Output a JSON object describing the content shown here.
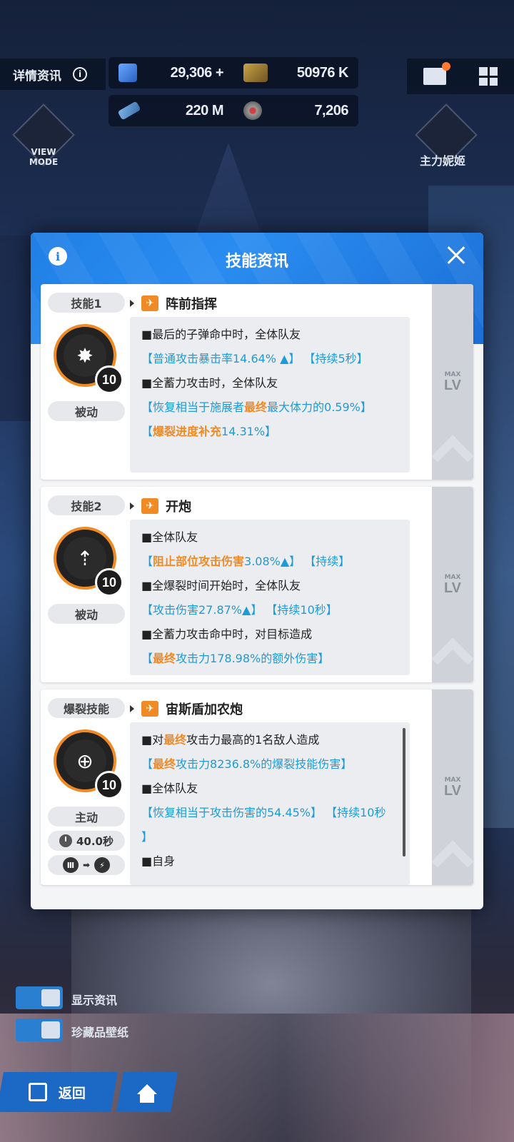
{
  "hud": {
    "details_label": "详情资讯",
    "gems": "29,306",
    "gems_plus": "+",
    "credits": "50976 K",
    "core_dust": "220 M",
    "items": "7,206"
  },
  "side": {
    "view_mode": "VIEW\nMODE",
    "main_nikke": "主力妮姬"
  },
  "modal": {
    "title": "技能资讯",
    "max_label": "MAX",
    "lv_label": "LV"
  },
  "skills": [
    {
      "slot": "技能1",
      "name": "阵前指挥",
      "type": "被动",
      "level": "10",
      "lines": [
        [
          {
            "t": "■最后的子弹命中时，全体队友",
            "c": ""
          }
        ],
        [
          {
            "t": "【普通攻击暴击率14.64% ▲】 【持续5秒】",
            "c": "blue"
          }
        ],
        [
          {
            "t": "■全蓄力攻击时，全体队友",
            "c": ""
          }
        ],
        [
          {
            "t": "【恢复相当于施展者",
            "c": "blue"
          },
          {
            "t": "最终",
            "c": "orange"
          },
          {
            "t": "最大体力的0.59%】",
            "c": "blue"
          }
        ],
        [
          {
            "t": "【",
            "c": "blue"
          },
          {
            "t": "爆裂进度补充",
            "c": "orange"
          },
          {
            "t": "14.31%】",
            "c": "blue"
          }
        ]
      ]
    },
    {
      "slot": "技能2",
      "name": "开炮",
      "type": "被动",
      "level": "10",
      "lines": [
        [
          {
            "t": "■全体队友",
            "c": ""
          }
        ],
        [
          {
            "t": "【",
            "c": "blue"
          },
          {
            "t": "阻止部位攻击伤害",
            "c": "orange"
          },
          {
            "t": "3.08%▲】 【持续】",
            "c": "blue"
          }
        ],
        [
          {
            "t": "■全爆裂时间开始时，全体队友",
            "c": ""
          }
        ],
        [
          {
            "t": "【攻击伤害27.87%▲】 【持续10秒】",
            "c": "blue"
          }
        ],
        [
          {
            "t": "■全蓄力攻击命中时，对目标造成",
            "c": ""
          }
        ],
        [
          {
            "t": "【",
            "c": "blue"
          },
          {
            "t": "最终",
            "c": "orange"
          },
          {
            "t": "攻击力178.98%的额外伤害】",
            "c": "blue"
          }
        ]
      ]
    },
    {
      "slot": "爆裂技能",
      "name": "宙斯盾加农炮",
      "type": "主动",
      "level": "10",
      "cooldown": "40.0秒",
      "lines": [
        [
          {
            "t": "■对",
            "c": ""
          },
          {
            "t": "最终",
            "c": "orange"
          },
          {
            "t": "攻击力最高的1名敌人造成",
            "c": ""
          }
        ],
        [
          {
            "t": "【",
            "c": "blue"
          },
          {
            "t": "最终",
            "c": "orange"
          },
          {
            "t": "攻击力8236.8%的爆裂技能伤害】",
            "c": "blue"
          }
        ],
        [
          {
            "t": "■全体队友",
            "c": ""
          }
        ],
        [
          {
            "t": "【恢复相当于攻击伤害的54.45%】 【持续10秒",
            "c": "blue"
          }
        ],
        [
          {
            "t": "】",
            "c": "blue"
          }
        ],
        [
          {
            "t": "■自身",
            "c": ""
          }
        ]
      ]
    }
  ],
  "bottom": {
    "toggle1": "显示资讯",
    "toggle2": "珍藏品壁纸",
    "back": "返回"
  }
}
